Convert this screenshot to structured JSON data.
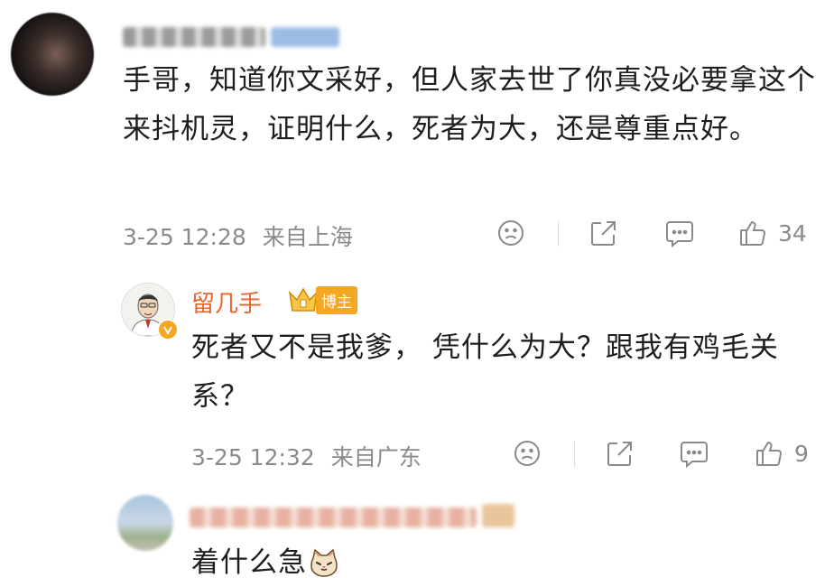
{
  "comment1": {
    "text": "手哥，知道你文采好，但人家去世了你真没必要拿这个来抖机灵，证明什么，死者为大，还是尊重点好。",
    "time": "3-25 12:28",
    "location": "来自上海",
    "likes": "34"
  },
  "reply": {
    "username": "留几手",
    "badge": "博主",
    "text": "死者又不是我爹， 凭什么为大？跟我有鸡毛关系？",
    "time": "3-25 12:32",
    "location": "来自广东",
    "likes": "9"
  },
  "comment3": {
    "text": "着什么急"
  },
  "icons": {
    "dislike": "sad-face-icon",
    "share": "share-icon",
    "comment": "comment-bubble-icon",
    "like": "thumbs-up-icon",
    "verified": "verified-v-icon",
    "cat": "cat-emoji-icon"
  },
  "colors": {
    "username": "#e8652e",
    "badge": "#f5a623",
    "meta": "#8a8a8a"
  }
}
